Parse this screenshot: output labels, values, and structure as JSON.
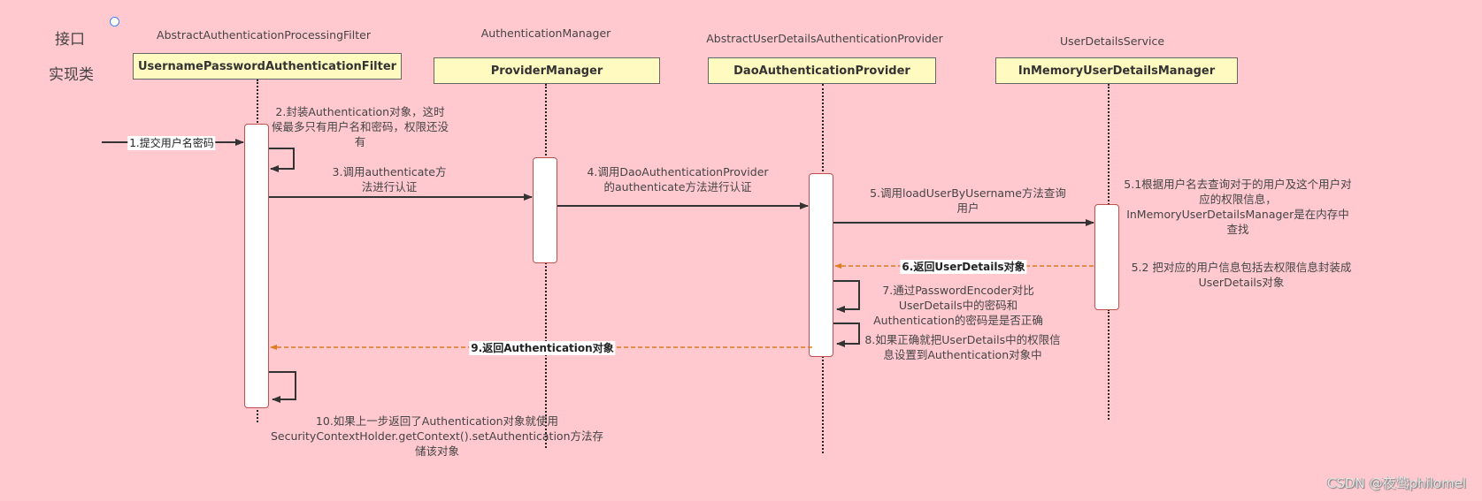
{
  "labels": {
    "interface_row": "接口",
    "impl_row": "实现类"
  },
  "participants": [
    {
      "interface": "AbstractAuthenticationProcessingFilter",
      "impl": "UsernamePasswordAuthenticationFilter"
    },
    {
      "interface": "AuthenticationManager",
      "impl": "ProviderManager"
    },
    {
      "interface": "AbstractUserDetailsAuthenticationProvider",
      "impl": "DaoAuthenticationProvider"
    },
    {
      "interface": "UserDetailsService",
      "impl": "InMemoryUserDetailsManager"
    }
  ],
  "messages": {
    "m1": "1.提交用户名密码",
    "m2": "2.封装Authentication对象，这时候最多只有用户名和密码，权限还没有",
    "m3": "3.调用authenticate方法进行认证",
    "m4": "4.调用DaoAuthenticationProvider的authenticate方法进行认证",
    "m5": "5.调用loadUserByUsername方法查询用户",
    "m5_1": "5.1根据用户名去查询对于的用户及这个用户对应的权限信息，InMemoryUserDetailsManager是在内存中查找",
    "m5_2": "5.2 把对应的用户信息包括去权限信息封装成UserDetails对象",
    "m6": "6.返回UserDetails对象",
    "m7": "7.通过PasswordEncoder对比UserDetails中的密码和Authentication的密码是是否正确",
    "m8": "8.如果正确就把UserDetails中的权限信息设置到Authentication对象中",
    "m9": "9.返回Authentication对象",
    "m10": "10.如果上一步返回了Authentication对象就使用SecurityContextHolder.getContext().setAuthentication方法存储该对象"
  },
  "watermark": "CSDN @夜莺philomel",
  "colors": {
    "background": "#ffc9cf",
    "box_fill": "#fffac0",
    "activation_border": "#c0504d",
    "return_arrow": "#e07b20",
    "call_arrow": "#333333"
  }
}
